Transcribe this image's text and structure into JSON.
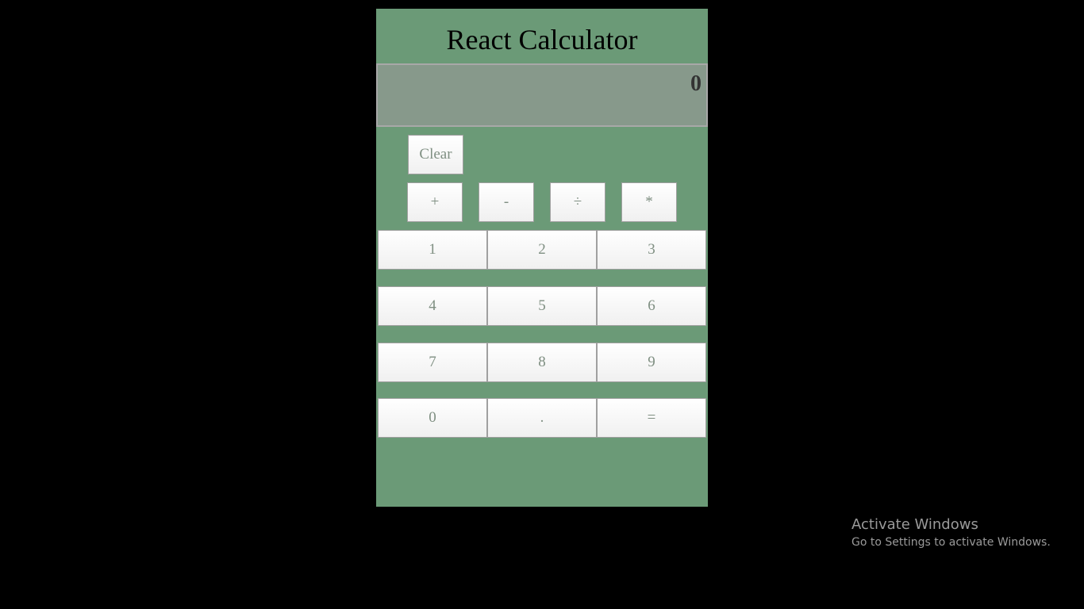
{
  "app": {
    "title": "React Calculator"
  },
  "display": {
    "value": "0"
  },
  "buttons": {
    "clear": "Clear",
    "operators": {
      "add": "+",
      "subtract": "-",
      "divide": "÷",
      "multiply": "*"
    },
    "digits": {
      "d1": "1",
      "d2": "2",
      "d3": "3",
      "d4": "4",
      "d5": "5",
      "d6": "6",
      "d7": "7",
      "d8": "8",
      "d9": "9",
      "d0": "0"
    },
    "decimal": ".",
    "equals": "="
  },
  "watermark": {
    "title": "Activate Windows",
    "subtitle": "Go to Settings to activate Windows."
  },
  "colors": {
    "page_background": "#000000",
    "calculator_background": "#6b9a77",
    "display_background": "#87998b",
    "button_text": "#7f8f82"
  }
}
